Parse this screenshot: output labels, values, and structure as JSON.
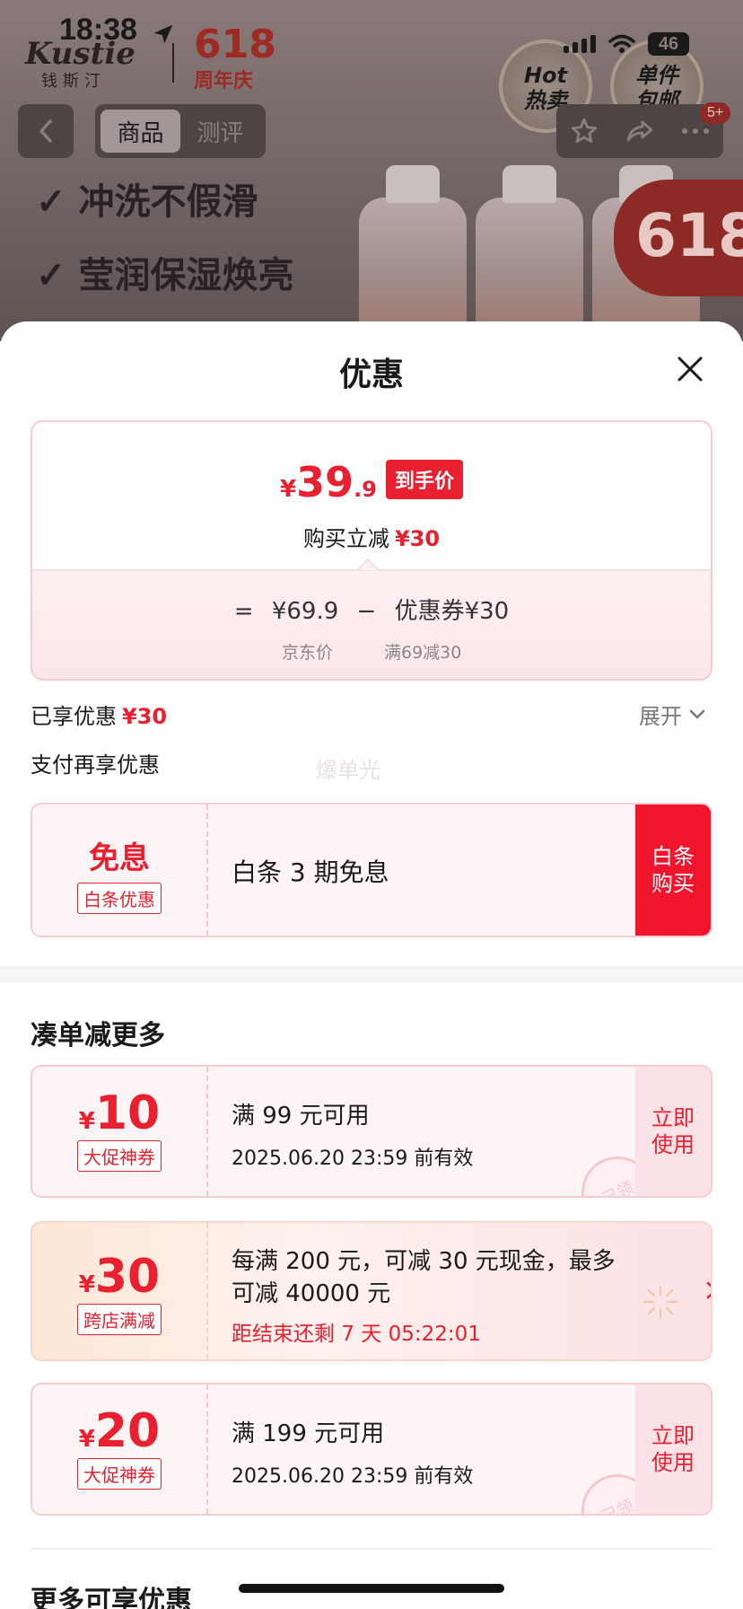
{
  "status_bar": {
    "time": "18:38",
    "battery": "46"
  },
  "background_page": {
    "brand_logo": "Kustie",
    "brand_sub": "钱斯汀",
    "badge_618": "618",
    "badge_618_sub": "周年庆",
    "promo_badges": [
      {
        "line1": "Hot",
        "line2": "热卖"
      },
      {
        "line1": "单件",
        "line2": "包邮"
      }
    ],
    "tabs": [
      "商品",
      "测评"
    ],
    "active_tab": "商品",
    "notification_count": "5+",
    "slogans": [
      "冲洗不假滑",
      "莹润保湿焕亮"
    ],
    "corner_badge": "618"
  },
  "sheet": {
    "title": "优惠",
    "final_price": {
      "currency": "¥",
      "integer": "39",
      "decimal": ".9",
      "tag": "到手价"
    },
    "instant_discount": {
      "label": "购买立减",
      "amount": "¥30"
    },
    "calculation": {
      "equals": "=",
      "jd_price": "¥69.9",
      "minus": "−",
      "coupon_label": "优惠券¥30",
      "jd_price_caption": "京东价",
      "coupon_caption": "满69减30"
    },
    "enjoyed": {
      "label": "已享优惠",
      "amount": "¥30"
    },
    "expand_label": "展开",
    "pay_more_label": "支付再享优惠",
    "watermark": "爆单光",
    "baitiao": {
      "headline": "免息",
      "tag": "白条优惠",
      "description": "白条 3 期免息",
      "action": [
        "白条",
        "购买"
      ]
    },
    "section_more_title": "凑单减更多",
    "coupons": [
      {
        "currency": "¥",
        "amount": "10",
        "tag": "大促神券",
        "line1": "满 99 元可用",
        "line2": "2025.06.20 23:59 前有效",
        "action": [
          "立即",
          "使用"
        ],
        "stamp": "已领"
      },
      {
        "currency": "¥",
        "amount": "20",
        "tag": "大促神券",
        "line1": "满 199 元可用",
        "line2": "2025.06.20 23:59 前有效",
        "action": [
          "立即",
          "使用"
        ],
        "stamp": "已领"
      }
    ],
    "cross_store": {
      "currency": "¥",
      "amount": "30",
      "tag": "跨店满减",
      "line1": "每满 200 元，可减 30 元现金，最多",
      "line2": "可减 40000 元",
      "countdown": "距结束还剩 7 天 05:22:01"
    },
    "section_bottom_title": "更多可享优惠"
  },
  "colors": {
    "accent_red": "#e8202f",
    "button_red": "#f0142d",
    "border_pink": "#f6ccd3"
  }
}
